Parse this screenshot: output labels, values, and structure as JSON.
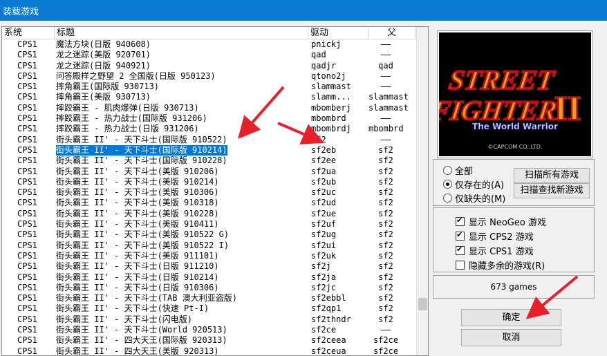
{
  "window": {
    "title": "装载游戏"
  },
  "list": {
    "columns": [
      "系统",
      "标题",
      "驱动",
      "父"
    ],
    "selected_index": 10,
    "rows": [
      [
        "CPS1",
        "魔法方块(日版 940608)",
        "pnickj",
        "——"
      ],
      [
        "CPS1",
        "龙之迷踪(美版 920701)",
        "qad",
        "——"
      ],
      [
        "CPS1",
        "龙之迷踪(日版 940921)",
        "qadjr",
        "qad"
      ],
      [
        "CPS1",
        "问答殿样之野望 2 全国版(日版 950123)",
        "qtono2j",
        "——"
      ],
      [
        "CPS1",
        "摔角霸王(国际版 930713)",
        "slammast",
        "——"
      ],
      [
        "CPS1",
        "摔角霸王(美版 930713)",
        "slamm...",
        "slammast"
      ],
      [
        "CPS1",
        "摔跤霸王 - 肌肉爆弹(日版 930713)",
        "mbomberj",
        "slammast"
      ],
      [
        "CPS1",
        "摔跤霸王 - 热力战士(国际版 931206)",
        "mbombrd",
        "——"
      ],
      [
        "CPS1",
        "摔跤霸王 - 热力战士(日版 931206)",
        "mbombrdj",
        "mbombrd"
      ],
      [
        "CPS1",
        "街头霸王 II' - 天下斗士(国际版 910522)",
        "sf2",
        "——"
      ],
      [
        "CPS1",
        "街头霸王 II' - 天下斗士(国际版 910214)",
        "sf2eb",
        "sf2"
      ],
      [
        "CPS1",
        "街头霸王 II' - 天下斗士(国际版 910228)",
        "sf2ee",
        "sf2"
      ],
      [
        "CPS1",
        "街头霸王 II' - 天下斗士(美版 910206)",
        "sf2ua",
        "sf2"
      ],
      [
        "CPS1",
        "街头霸王 II' - 天下斗士(美版 910214)",
        "sf2ub",
        "sf2"
      ],
      [
        "CPS1",
        "街头霸王 II' - 天下斗士(美版 910306)",
        "sf2uc",
        "sf2"
      ],
      [
        "CPS1",
        "街头霸王 II' - 天下斗士(美版 910318)",
        "sf2ud",
        "sf2"
      ],
      [
        "CPS1",
        "街头霸王 II' - 天下斗士(美版 910228)",
        "sf2ue",
        "sf2"
      ],
      [
        "CPS1",
        "街头霸王 II' - 天下斗士(美版 910411)",
        "sf2uf",
        "sf2"
      ],
      [
        "CPS1",
        "街头霸王 II' - 天下斗士(美版 910522 G)",
        "sf2ug",
        "sf2"
      ],
      [
        "CPS1",
        "街头霸王 II' - 天下斗士(美版 910522 I)",
        "sf2ui",
        "sf2"
      ],
      [
        "CPS1",
        "街头霸王 II' - 天下斗士(美版 911101)",
        "sf2uk",
        "sf2"
      ],
      [
        "CPS1",
        "街头霸王 II' - 天下斗士(日版 911210)",
        "sf2j",
        "sf2"
      ],
      [
        "CPS1",
        "街头霸王 II' - 天下斗士(日版 910214)",
        "sf2ja",
        "sf2"
      ],
      [
        "CPS1",
        "街头霸王 II' - 天下斗士(日版 910306)",
        "sf2jc",
        "sf2"
      ],
      [
        "CPS1",
        "街头霸王 II' - 天下斗士(TAB 澳大利亚盗版)",
        "sf2ebbl",
        "sf2"
      ],
      [
        "CPS1",
        "街头霸王 II' - 天下斗士(快速 Pt-I)",
        "sf2qp1",
        "sf2"
      ],
      [
        "CPS1",
        "街头霸王 II' - 天下斗士(闪电版)",
        "sf2thndr",
        "sf2"
      ],
      [
        "CPS1",
        "街头霸王 II' - 天下斗士(World 920513)",
        "sf2ce",
        "——"
      ],
      [
        "CPS1",
        "街头霸王 II' - 四大天王(国际版 920313)",
        "sf2ceea",
        "sf2ce"
      ],
      [
        "CPS1",
        "街头霸王 II' - 四大天王(美版 920313)",
        "sf2ceua",
        "sf2ce"
      ]
    ]
  },
  "preview": {
    "logo_line1": "STREET",
    "logo_line2": "FIGHTER",
    "logo_numeral": "II",
    "logo_subtitle": "The World Warrior",
    "copyright": "©CAPCOM CO.,LTD."
  },
  "filter": {
    "options": [
      "全部",
      "仅存在的(A)",
      "仅缺失的(M)"
    ],
    "selected": 1,
    "scan_all_label": "扫描所有游戏",
    "scan_new_label": "扫描查找新游戏"
  },
  "display": {
    "checkboxes": [
      {
        "label": "显示 NeoGeo 游戏",
        "checked": true
      },
      {
        "label": "显示 CPS2 游戏",
        "checked": true
      },
      {
        "label": "显示 CPS1 游戏",
        "checked": true
      },
      {
        "label": "隐藏多余的游戏(R)",
        "checked": false
      }
    ]
  },
  "status": {
    "count_text": "673 games"
  },
  "buttons": {
    "ok_label": "确定",
    "cancel_label": "取消"
  },
  "colors": {
    "titlebar": "#0a7ad3",
    "selection": "#0078d7",
    "annotation_arrow": "#e8202c"
  }
}
